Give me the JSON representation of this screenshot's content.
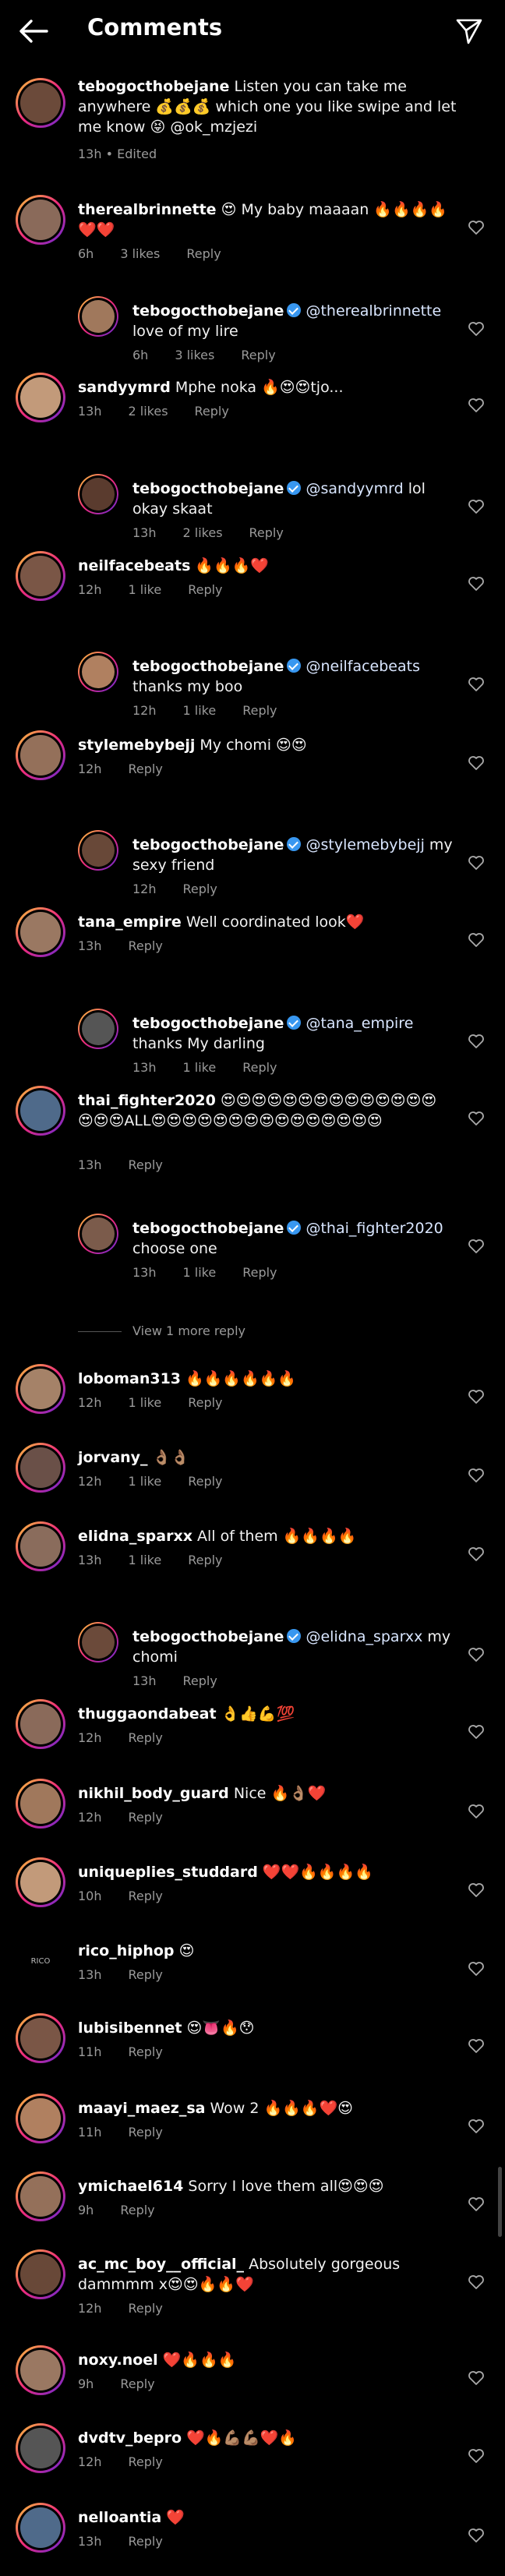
{
  "header": {
    "title": "Comments"
  },
  "caption": {
    "user": "tebogocthobejane",
    "text": " Listen you can take me anywhere 💰💰💰 which one you like swipe and let me know 😝 @ok_mzjezi",
    "meta": "13h • Edited"
  },
  "comments": [
    {
      "user": "therealbrinnette",
      "text": " 😍 My baby maaaan 🔥🔥🔥🔥❤️❤️",
      "time": "6h",
      "likes": "3 likes",
      "reply": "Reply",
      "is_reply": false,
      "verified": false
    },
    {
      "user": "tebogocthobejane",
      "mention": "@therealbrinnette",
      "text": " love of my lire",
      "time": "6h",
      "likes": "3 likes",
      "reply": "Reply",
      "is_reply": true,
      "verified": true
    },
    {
      "user": "sandyymrd",
      "text": " Mphe noka 🔥😍😍tjo...",
      "time": "13h",
      "likes": "2 likes",
      "reply": "Reply",
      "is_reply": false,
      "verified": false
    },
    {
      "user": "tebogocthobejane",
      "mention": "@sandyymrd",
      "text": " lol okay skaat",
      "time": "13h",
      "likes": "2 likes",
      "reply": "Reply",
      "is_reply": true,
      "verified": true
    },
    {
      "user": "neilfacebeats",
      "text": " 🔥🔥🔥❤️",
      "time": "12h",
      "likes": "1 like",
      "reply": "Reply",
      "is_reply": false,
      "verified": false
    },
    {
      "user": "tebogocthobejane",
      "mention": "@neilfacebeats",
      "text": " thanks my boo",
      "time": "12h",
      "likes": "1 like",
      "reply": "Reply",
      "is_reply": true,
      "verified": true
    },
    {
      "user": "stylemebybejj",
      "text": " My chomi 😍😍",
      "time": "12h",
      "likes": "",
      "reply": "Reply",
      "is_reply": false,
      "verified": false
    },
    {
      "user": "tebogocthobejane",
      "mention": "@stylemebybejj",
      "text": " my sexy friend",
      "time": "12h",
      "likes": "",
      "reply": "Reply",
      "is_reply": true,
      "verified": true
    },
    {
      "user": "tana_empire",
      "text": " Well coordinated look❤️",
      "time": "13h",
      "likes": "",
      "reply": "Reply",
      "is_reply": false,
      "verified": false
    },
    {
      "user": "tebogocthobejane",
      "mention": "@tana_empire",
      "text": " thanks  My darling",
      "time": "13h",
      "likes": "1 like",
      "reply": "Reply",
      "is_reply": true,
      "verified": true
    },
    {
      "user": "thai_fighter2020",
      "text": " 😍😍😍😍😍😍😍😍😍😍😍😍😍😍😍😍😍ALL😍😍😍😍😍😍😍😍😍😍😍😍😍😍😍",
      "time": "13h",
      "likes": "",
      "reply": "Reply",
      "is_reply": false,
      "verified": false
    },
    {
      "user": "tebogocthobejane",
      "mention": "@thai_fighter2020",
      "text": " choose one",
      "time": "13h",
      "likes": "1 like",
      "reply": "Reply",
      "is_reply": true,
      "verified": true
    },
    {
      "user": "loboman313",
      "text": " 🔥🔥🔥🔥🔥🔥",
      "time": "12h",
      "likes": "1 like",
      "reply": "Reply",
      "is_reply": false,
      "verified": false
    },
    {
      "user": "jorvany_",
      "text": " 👌🏽👌🏽",
      "time": "12h",
      "likes": "1 like",
      "reply": "Reply",
      "is_reply": false,
      "verified": false
    },
    {
      "user": "elidna_sparxx",
      "text": " All of them 🔥🔥🔥🔥",
      "time": "13h",
      "likes": "1 like",
      "reply": "Reply",
      "is_reply": false,
      "verified": false
    },
    {
      "user": "tebogocthobejane",
      "mention": "@elidna_sparxx",
      "text": " my chomi",
      "time": "13h",
      "likes": "",
      "reply": "Reply",
      "is_reply": true,
      "verified": true
    },
    {
      "user": "thuggaondabeat",
      "text": " 👌👍💪💯",
      "time": "12h",
      "likes": "",
      "reply": "Reply",
      "is_reply": false,
      "verified": false
    },
    {
      "user": "nikhil_body_guard",
      "text": " Nice 🔥👌🏽❤️",
      "time": "12h",
      "likes": "",
      "reply": "Reply",
      "is_reply": false,
      "verified": false
    },
    {
      "user": "uniqueplies_studdard",
      "text": " ❤️❤️🔥🔥🔥🔥",
      "time": "10h",
      "likes": "",
      "reply": "Reply",
      "is_reply": false,
      "verified": false
    },
    {
      "user": "rico_hiphop",
      "text": " 😍",
      "time": "13h",
      "likes": "",
      "reply": "Reply",
      "is_reply": false,
      "verified": false
    },
    {
      "user": "lubisibennet",
      "text": " 😍👅🔥😯",
      "time": "11h",
      "likes": "",
      "reply": "Reply",
      "is_reply": false,
      "verified": false
    },
    {
      "user": "maayi_maez_sa",
      "text": " Wow 2 🔥🔥🔥❤️😍",
      "time": "11h",
      "likes": "",
      "reply": "Reply",
      "is_reply": false,
      "verified": false
    },
    {
      "user": "ymichael614",
      "text": " Sorry I love them all😍😍😍",
      "time": "9h",
      "likes": "",
      "reply": "Reply",
      "is_reply": false,
      "verified": false
    },
    {
      "user": "ac_mc_boy__official_",
      "text": " Absolutely gorgeous dammmm x😍😍🔥🔥❤️",
      "time": "12h",
      "likes": "",
      "reply": "Reply",
      "is_reply": false,
      "verified": false
    },
    {
      "user": "noxy.noel",
      "text": " ❤️🔥🔥🔥",
      "time": "9h",
      "likes": "",
      "reply": "Reply",
      "is_reply": false,
      "verified": false
    },
    {
      "user": "dvdtv_bepro",
      "text": " ❤️🔥💪🏽💪🏽❤️🔥",
      "time": "12h",
      "likes": "",
      "reply": "Reply",
      "is_reply": false,
      "verified": false
    },
    {
      "user": "nelloantia",
      "text": " ❤️",
      "time": "13h",
      "likes": "",
      "reply": "Reply",
      "is_reply": false,
      "verified": false
    }
  ],
  "view_more": "View 1 more reply",
  "avatar_labels": {
    "rico_hiphop": "RICO"
  },
  "colors": {
    "background": "#000000",
    "meta": "#9a9a9a",
    "verified": "#3897f0",
    "ring": "#ee2a7b"
  },
  "icons": [
    "back-arrow-icon",
    "send-icon",
    "heart-icon",
    "verified-icon"
  ]
}
